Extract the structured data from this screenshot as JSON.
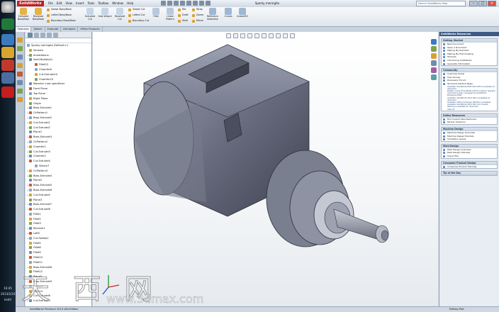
{
  "app": {
    "logo": "SolidWorks",
    "menu": [
      "File",
      "Edit",
      "View",
      "Insert",
      "Tools",
      "Toolbox",
      "Window",
      "Help"
    ],
    "doc_title": "Sparky meringite",
    "search_placeholder": "Search SolidWorks Help",
    "window_controls": [
      "–",
      "□",
      "×"
    ]
  },
  "ribbon": {
    "big_buttons": [
      {
        "label": "Extruded Boss/Base",
        "icon": "extrude-icon"
      },
      {
        "label": "Revolved Boss/Base",
        "icon": "revolve-icon"
      },
      {
        "label": "Extruded Cut",
        "icon": "extruded-cut-icon"
      },
      {
        "label": "Hole Wizard",
        "icon": "hole-wizard-icon"
      },
      {
        "label": "Revolved Cut",
        "icon": "revolved-cut-icon"
      },
      {
        "label": "Fillet",
        "icon": "fillet-icon"
      },
      {
        "label": "Linear Pattern",
        "icon": "linear-pattern-icon"
      },
      {
        "label": "Reference Geometry",
        "icon": "reference-geometry-icon"
      },
      {
        "label": "Curves",
        "icon": "curves-icon"
      },
      {
        "label": "Instant3D",
        "icon": "instant3d-icon"
      }
    ],
    "small_buttons": [
      "Swept Boss/Base",
      "Lofted Boss/Base",
      "Boundary Boss/Base",
      "Swept Cut",
      "Lofted Cut",
      "Boundary Cut",
      "Rib",
      "Draft",
      "Shell",
      "Wrap",
      "Dome",
      "Mirror"
    ]
  },
  "command_tabs": [
    "Features",
    "Sketch",
    "Evaluate",
    "DimXpert",
    "Office Products"
  ],
  "tree": {
    "root": "Sparky meringite (Default<<",
    "nodes": [
      {
        "label": "Sensors",
        "expand": ""
      },
      {
        "label": "Annotations",
        "expand": "+"
      },
      {
        "label": "Solid Bodies(4)",
        "expand": "-"
      },
      {
        "label": "Fillet22",
        "expand": "",
        "indent": 2
      },
      {
        "label": "Chamfer8",
        "expand": "",
        "indent": 2
      },
      {
        "label": "Cut-Extrude10",
        "expand": "",
        "indent": 2
      },
      {
        "label": "Chamfer23",
        "expand": "",
        "indent": 2
      },
      {
        "label": "Material <not specified>",
        "expand": ""
      },
      {
        "label": "Front Plane",
        "expand": ""
      },
      {
        "label": "Top Plane",
        "expand": ""
      },
      {
        "label": "Right Plane",
        "expand": ""
      },
      {
        "label": "Origin",
        "expand": ""
      },
      {
        "label": "Boss-Extrude1",
        "expand": "+"
      },
      {
        "label": "CirPattern1",
        "expand": "+"
      },
      {
        "label": "Boss-Extrude2",
        "expand": "+"
      },
      {
        "label": "Cut-Extrude1",
        "expand": "+"
      },
      {
        "label": "Cut-Extrude2",
        "expand": "+"
      },
      {
        "label": "Plane1",
        "expand": ""
      },
      {
        "label": "Boss-Extrude3",
        "expand": "+"
      },
      {
        "label": "CirPattern2",
        "expand": "+"
      },
      {
        "label": "Chamfer1",
        "expand": "+"
      },
      {
        "label": "Cut-Extrude3",
        "expand": "+"
      },
      {
        "label": "Chamfer2",
        "expand": "+"
      },
      {
        "label": "Cut-Extrude4",
        "expand": "-"
      },
      {
        "label": "Sketch7",
        "expand": "",
        "indent": 2
      },
      {
        "label": "CirPattern3",
        "expand": "+"
      },
      {
        "label": "Boss-Extrude4",
        "expand": "+"
      },
      {
        "label": "Plane2",
        "expand": ""
      },
      {
        "label": "Boss-Extrude5",
        "expand": "+"
      },
      {
        "label": "Boss-Extrude6",
        "expand": "+"
      },
      {
        "label": "Cut-Extrude5",
        "expand": "+"
      },
      {
        "label": "Plane3",
        "expand": ""
      },
      {
        "label": "Boss-Extrude7",
        "expand": "+"
      },
      {
        "label": "Cut-Extrude6",
        "expand": "+"
      },
      {
        "label": "Fillet1",
        "expand": ""
      },
      {
        "label": "Fillet2",
        "expand": ""
      },
      {
        "label": "Fillet3",
        "expand": ""
      },
      {
        "label": "Revolve1",
        "expand": "+"
      },
      {
        "label": "LoftS",
        "expand": "+"
      },
      {
        "label": "Cut-Sweep1",
        "expand": "+"
      },
      {
        "label": "Fillet5",
        "expand": ""
      },
      {
        "label": "Fillet6",
        "expand": ""
      },
      {
        "label": "Fillet9",
        "expand": ""
      },
      {
        "label": "Fillet10",
        "expand": ""
      },
      {
        "label": "Fillet11",
        "expand": ""
      },
      {
        "label": "Boss-Extrude8",
        "expand": "+"
      },
      {
        "label": "Fillet12",
        "expand": ""
      },
      {
        "label": "Plane5",
        "expand": ""
      },
      {
        "label": "Boss-Extrude9",
        "expand": "+"
      },
      {
        "label": "Fillet13",
        "expand": ""
      },
      {
        "label": "Fillet14",
        "expand": ""
      },
      {
        "label": "Cut-Extrude8",
        "expand": "+"
      },
      {
        "label": "Cut-Extrude9",
        "expand": "+"
      }
    ]
  },
  "taskpane": {
    "header": "SolidWorks Resources",
    "sections": [
      {
        "title": "Getting Started",
        "items": [
          "New Document",
          "Open a Document",
          "Making My First Part",
          "Making My First Drawing",
          "Tutorials",
          "Introducing SolidWorks",
          "Generate Information"
        ]
      },
      {
        "title": "Community",
        "items": [
          "Customer Portal",
          "User Groups",
          "Discussion Forum",
          "Technical Alerts & News"
        ],
        "news": [
          "Available: SolidWorks PDM 2013 SP3 is available for download",
          "Bulletin: Issue Errors/Stats (2013) Contains upgrade instructions when managed by SolidWorks Enterprise PDM",
          "Available: SolidWorks 2013 SP2 is available for download",
          "Available: ODVA Composer VR2013 is available",
          "Available: SolidWorks 2013 SP1.0 for Quality Starting is available for download",
          "View All"
        ]
      },
      {
        "title": "Online Resources",
        "items": [
          "Find Custom Manufacturers",
          "Partner Solutions"
        ]
      },
      {
        "title": "Machine Design",
        "items": [
          "Machine Design Overview",
          "Machine Design Tutorials",
          "Simulation Issues"
        ]
      },
      {
        "title": "Mold Design",
        "items": [
          "Mold Design Overview",
          "Mold Design Tutorials",
          "Import File"
        ]
      },
      {
        "title": "Consumer Product Design",
        "items": [
          "Consumer Product Tutorials"
        ]
      },
      {
        "title": "Tip of the Day",
        "items": []
      }
    ]
  },
  "status": {
    "left": "SolidWorks Premium 2013 x64 Edition",
    "right": "Editing Part"
  },
  "taskbar": {
    "time": "16:45",
    "date": "2013/2/24",
    "label": "kedd"
  },
  "watermark": {
    "text": "天 西 网",
    "url": "www.3dmax.com"
  }
}
